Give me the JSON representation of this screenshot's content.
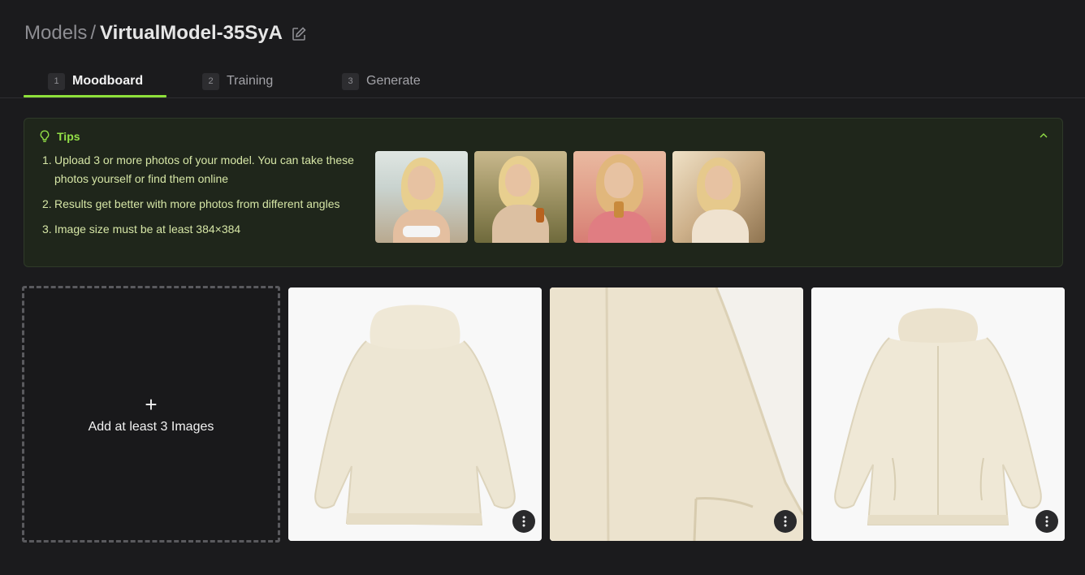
{
  "breadcrumb": {
    "root": "Models",
    "separator": "/",
    "current": "VirtualModel-35SyA",
    "edit_icon": "pencil-icon"
  },
  "tabs": [
    {
      "num": "1",
      "label": "Moodboard",
      "active": true
    },
    {
      "num": "2",
      "label": "Training",
      "active": false
    },
    {
      "num": "3",
      "label": "Generate",
      "active": false
    }
  ],
  "tips": {
    "title": "Tips",
    "icon": "lightbulb-icon",
    "collapse_icon": "chevron-up-icon",
    "items": [
      {
        "num": "1.",
        "text": "Upload 3 or more photos of your model. You can take these photos yourself or find them online"
      },
      {
        "num": "2.",
        "text": "Results get better with more photos from different angles"
      },
      {
        "num": "3.",
        "text": "Image size must be at least 384×384"
      }
    ]
  },
  "upload": {
    "plus": "+",
    "label": "Add at least 3 Images"
  },
  "colors": {
    "accent": "#8ee03a",
    "background": "#1b1b1d",
    "tips_bg": "#1f261b",
    "tips_text": "#d6e6a6"
  }
}
